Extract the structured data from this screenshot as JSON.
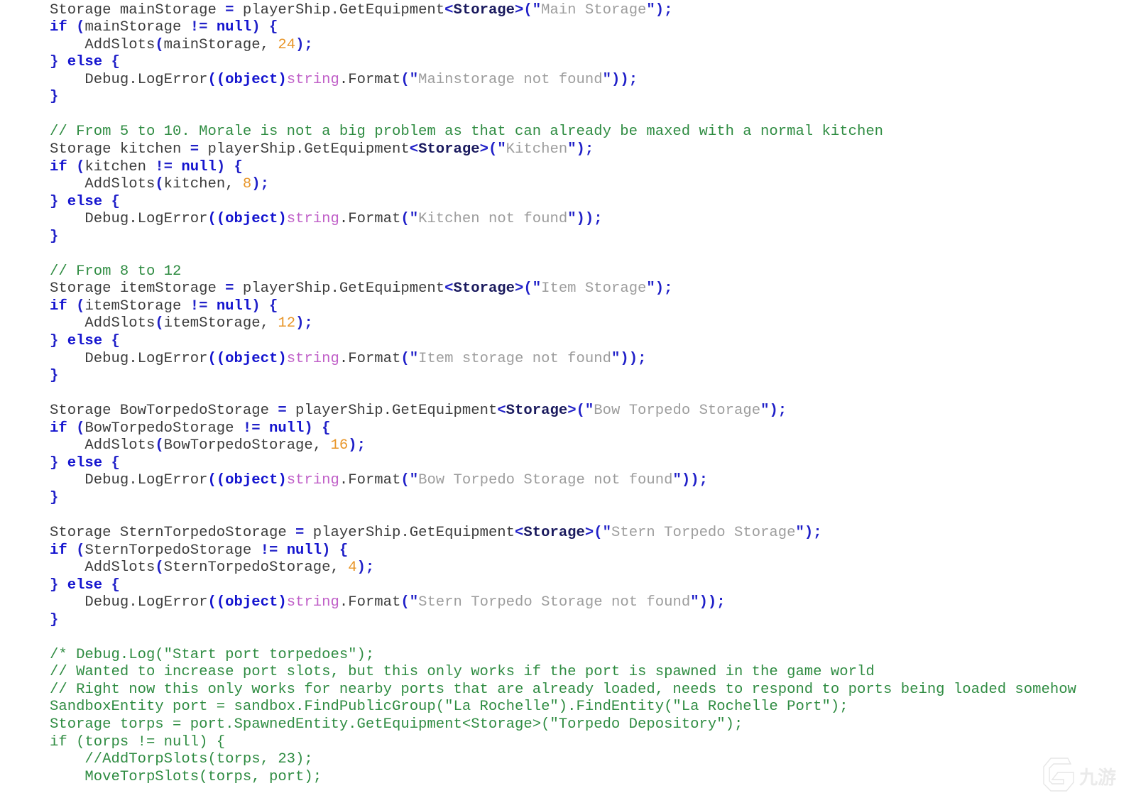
{
  "editor": {
    "background_color": "#ffffff",
    "language": "csharp",
    "font_size_px": 20.6,
    "line_height_px": 24.55,
    "theme_colors": {
      "plain": "#3c3c3c",
      "keyword": "#1414cf",
      "type": "#1a1a5e",
      "punctuation": "#2020c8",
      "number": "#e8962a",
      "string": "#9d9d9d",
      "string_quote": "#2020c8",
      "special_keyword": "#c060c8",
      "comment": "#2f8c42"
    }
  },
  "watermark": {
    "text": "九游",
    "color": "#c9c9c9"
  },
  "code": {
    "lines": [
      [
        {
          "t": "Storage mainStorage ",
          "c": "plain"
        },
        {
          "t": "=",
          "c": "punc"
        },
        {
          "t": " playerShip",
          "c": "plain"
        },
        {
          "t": ".",
          "c": "plain"
        },
        {
          "t": "GetEquipment",
          "c": "plain"
        },
        {
          "t": "<",
          "c": "punc"
        },
        {
          "t": "Storage",
          "c": "type"
        },
        {
          "t": ">",
          "c": "punc"
        },
        {
          "t": "(",
          "c": "punc"
        },
        {
          "t": "\"",
          "c": "strq"
        },
        {
          "t": "Main Storage",
          "c": "str"
        },
        {
          "t": "\"",
          "c": "strq"
        },
        {
          "t": ")",
          "c": "punc"
        },
        {
          "t": ";",
          "c": "punc"
        }
      ],
      [
        {
          "t": "if",
          "c": "kw"
        },
        {
          "t": " ",
          "c": "plain"
        },
        {
          "t": "(",
          "c": "punc"
        },
        {
          "t": "mainStorage ",
          "c": "plain"
        },
        {
          "t": "!=",
          "c": "punc"
        },
        {
          "t": " ",
          "c": "plain"
        },
        {
          "t": "null",
          "c": "kw"
        },
        {
          "t": ")",
          "c": "punc"
        },
        {
          "t": " ",
          "c": "plain"
        },
        {
          "t": "{",
          "c": "punc"
        }
      ],
      [
        {
          "t": "    AddSlots",
          "c": "plain"
        },
        {
          "t": "(",
          "c": "punc"
        },
        {
          "t": "mainStorage, ",
          "c": "plain"
        },
        {
          "t": "24",
          "c": "num"
        },
        {
          "t": ")",
          "c": "punc"
        },
        {
          "t": ";",
          "c": "punc"
        }
      ],
      [
        {
          "t": "}",
          "c": "punc"
        },
        {
          "t": " ",
          "c": "plain"
        },
        {
          "t": "else",
          "c": "kw"
        },
        {
          "t": " ",
          "c": "plain"
        },
        {
          "t": "{",
          "c": "punc"
        }
      ],
      [
        {
          "t": "    Debug",
          "c": "plain"
        },
        {
          "t": ".",
          "c": "plain"
        },
        {
          "t": "LogError",
          "c": "plain"
        },
        {
          "t": "((object)",
          "c": "cast"
        },
        {
          "t": "string",
          "c": "special"
        },
        {
          "t": ".",
          "c": "plain"
        },
        {
          "t": "Format",
          "c": "plain"
        },
        {
          "t": "(",
          "c": "punc"
        },
        {
          "t": "\"",
          "c": "strq"
        },
        {
          "t": "Mainstorage not found",
          "c": "str"
        },
        {
          "t": "\"",
          "c": "strq"
        },
        {
          "t": "))",
          "c": "punc"
        },
        {
          "t": ";",
          "c": "punc"
        }
      ],
      [
        {
          "t": "}",
          "c": "punc"
        }
      ],
      [],
      [
        {
          "t": "// From 5 to 10. Morale is not a big problem as that can already be maxed with a normal kitchen",
          "c": "comment"
        }
      ],
      [
        {
          "t": "Storage kitchen ",
          "c": "plain"
        },
        {
          "t": "=",
          "c": "punc"
        },
        {
          "t": " playerShip",
          "c": "plain"
        },
        {
          "t": ".",
          "c": "plain"
        },
        {
          "t": "GetEquipment",
          "c": "plain"
        },
        {
          "t": "<",
          "c": "punc"
        },
        {
          "t": "Storage",
          "c": "type"
        },
        {
          "t": ">",
          "c": "punc"
        },
        {
          "t": "(",
          "c": "punc"
        },
        {
          "t": "\"",
          "c": "strq"
        },
        {
          "t": "Kitchen",
          "c": "str"
        },
        {
          "t": "\"",
          "c": "strq"
        },
        {
          "t": ")",
          "c": "punc"
        },
        {
          "t": ";",
          "c": "punc"
        }
      ],
      [
        {
          "t": "if",
          "c": "kw"
        },
        {
          "t": " ",
          "c": "plain"
        },
        {
          "t": "(",
          "c": "punc"
        },
        {
          "t": "kitchen ",
          "c": "plain"
        },
        {
          "t": "!=",
          "c": "punc"
        },
        {
          "t": " ",
          "c": "plain"
        },
        {
          "t": "null",
          "c": "kw"
        },
        {
          "t": ")",
          "c": "punc"
        },
        {
          "t": " ",
          "c": "plain"
        },
        {
          "t": "{",
          "c": "punc"
        }
      ],
      [
        {
          "t": "    AddSlots",
          "c": "plain"
        },
        {
          "t": "(",
          "c": "punc"
        },
        {
          "t": "kitchen, ",
          "c": "plain"
        },
        {
          "t": "8",
          "c": "num"
        },
        {
          "t": ")",
          "c": "punc"
        },
        {
          "t": ";",
          "c": "punc"
        }
      ],
      [
        {
          "t": "}",
          "c": "punc"
        },
        {
          "t": " ",
          "c": "plain"
        },
        {
          "t": "else",
          "c": "kw"
        },
        {
          "t": " ",
          "c": "plain"
        },
        {
          "t": "{",
          "c": "punc"
        }
      ],
      [
        {
          "t": "    Debug",
          "c": "plain"
        },
        {
          "t": ".",
          "c": "plain"
        },
        {
          "t": "LogError",
          "c": "plain"
        },
        {
          "t": "((object)",
          "c": "cast"
        },
        {
          "t": "string",
          "c": "special"
        },
        {
          "t": ".",
          "c": "plain"
        },
        {
          "t": "Format",
          "c": "plain"
        },
        {
          "t": "(",
          "c": "punc"
        },
        {
          "t": "\"",
          "c": "strq"
        },
        {
          "t": "Kitchen not found",
          "c": "str"
        },
        {
          "t": "\"",
          "c": "strq"
        },
        {
          "t": "))",
          "c": "punc"
        },
        {
          "t": ";",
          "c": "punc"
        }
      ],
      [
        {
          "t": "}",
          "c": "punc"
        }
      ],
      [],
      [
        {
          "t": "// From 8 to 12",
          "c": "comment"
        }
      ],
      [
        {
          "t": "Storage itemStorage ",
          "c": "plain"
        },
        {
          "t": "=",
          "c": "punc"
        },
        {
          "t": " playerShip",
          "c": "plain"
        },
        {
          "t": ".",
          "c": "plain"
        },
        {
          "t": "GetEquipment",
          "c": "plain"
        },
        {
          "t": "<",
          "c": "punc"
        },
        {
          "t": "Storage",
          "c": "type"
        },
        {
          "t": ">",
          "c": "punc"
        },
        {
          "t": "(",
          "c": "punc"
        },
        {
          "t": "\"",
          "c": "strq"
        },
        {
          "t": "Item Storage",
          "c": "str"
        },
        {
          "t": "\"",
          "c": "strq"
        },
        {
          "t": ")",
          "c": "punc"
        },
        {
          "t": ";",
          "c": "punc"
        }
      ],
      [
        {
          "t": "if",
          "c": "kw"
        },
        {
          "t": " ",
          "c": "plain"
        },
        {
          "t": "(",
          "c": "punc"
        },
        {
          "t": "itemStorage ",
          "c": "plain"
        },
        {
          "t": "!=",
          "c": "punc"
        },
        {
          "t": " ",
          "c": "plain"
        },
        {
          "t": "null",
          "c": "kw"
        },
        {
          "t": ")",
          "c": "punc"
        },
        {
          "t": " ",
          "c": "plain"
        },
        {
          "t": "{",
          "c": "punc"
        }
      ],
      [
        {
          "t": "    AddSlots",
          "c": "plain"
        },
        {
          "t": "(",
          "c": "punc"
        },
        {
          "t": "itemStorage, ",
          "c": "plain"
        },
        {
          "t": "12",
          "c": "num"
        },
        {
          "t": ")",
          "c": "punc"
        },
        {
          "t": ";",
          "c": "punc"
        }
      ],
      [
        {
          "t": "}",
          "c": "punc"
        },
        {
          "t": " ",
          "c": "plain"
        },
        {
          "t": "else",
          "c": "kw"
        },
        {
          "t": " ",
          "c": "plain"
        },
        {
          "t": "{",
          "c": "punc"
        }
      ],
      [
        {
          "t": "    Debug",
          "c": "plain"
        },
        {
          "t": ".",
          "c": "plain"
        },
        {
          "t": "LogError",
          "c": "plain"
        },
        {
          "t": "((object)",
          "c": "cast"
        },
        {
          "t": "string",
          "c": "special"
        },
        {
          "t": ".",
          "c": "plain"
        },
        {
          "t": "Format",
          "c": "plain"
        },
        {
          "t": "(",
          "c": "punc"
        },
        {
          "t": "\"",
          "c": "strq"
        },
        {
          "t": "Item storage not found",
          "c": "str"
        },
        {
          "t": "\"",
          "c": "strq"
        },
        {
          "t": "))",
          "c": "punc"
        },
        {
          "t": ";",
          "c": "punc"
        }
      ],
      [
        {
          "t": "}",
          "c": "punc"
        }
      ],
      [],
      [
        {
          "t": "Storage BowTorpedoStorage ",
          "c": "plain"
        },
        {
          "t": "=",
          "c": "punc"
        },
        {
          "t": " playerShip",
          "c": "plain"
        },
        {
          "t": ".",
          "c": "plain"
        },
        {
          "t": "GetEquipment",
          "c": "plain"
        },
        {
          "t": "<",
          "c": "punc"
        },
        {
          "t": "Storage",
          "c": "type"
        },
        {
          "t": ">",
          "c": "punc"
        },
        {
          "t": "(",
          "c": "punc"
        },
        {
          "t": "\"",
          "c": "strq"
        },
        {
          "t": "Bow Torpedo Storage",
          "c": "str"
        },
        {
          "t": "\"",
          "c": "strq"
        },
        {
          "t": ")",
          "c": "punc"
        },
        {
          "t": ";",
          "c": "punc"
        }
      ],
      [
        {
          "t": "if",
          "c": "kw"
        },
        {
          "t": " ",
          "c": "plain"
        },
        {
          "t": "(",
          "c": "punc"
        },
        {
          "t": "BowTorpedoStorage ",
          "c": "plain"
        },
        {
          "t": "!=",
          "c": "punc"
        },
        {
          "t": " ",
          "c": "plain"
        },
        {
          "t": "null",
          "c": "kw"
        },
        {
          "t": ")",
          "c": "punc"
        },
        {
          "t": " ",
          "c": "plain"
        },
        {
          "t": "{",
          "c": "punc"
        }
      ],
      [
        {
          "t": "    AddSlots",
          "c": "plain"
        },
        {
          "t": "(",
          "c": "punc"
        },
        {
          "t": "BowTorpedoStorage, ",
          "c": "plain"
        },
        {
          "t": "16",
          "c": "num"
        },
        {
          "t": ")",
          "c": "punc"
        },
        {
          "t": ";",
          "c": "punc"
        }
      ],
      [
        {
          "t": "}",
          "c": "punc"
        },
        {
          "t": " ",
          "c": "plain"
        },
        {
          "t": "else",
          "c": "kw"
        },
        {
          "t": " ",
          "c": "plain"
        },
        {
          "t": "{",
          "c": "punc"
        }
      ],
      [
        {
          "t": "    Debug",
          "c": "plain"
        },
        {
          "t": ".",
          "c": "plain"
        },
        {
          "t": "LogError",
          "c": "plain"
        },
        {
          "t": "((object)",
          "c": "cast"
        },
        {
          "t": "string",
          "c": "special"
        },
        {
          "t": ".",
          "c": "plain"
        },
        {
          "t": "Format",
          "c": "plain"
        },
        {
          "t": "(",
          "c": "punc"
        },
        {
          "t": "\"",
          "c": "strq"
        },
        {
          "t": "Bow Torpedo Storage not found",
          "c": "str"
        },
        {
          "t": "\"",
          "c": "strq"
        },
        {
          "t": "))",
          "c": "punc"
        },
        {
          "t": ";",
          "c": "punc"
        }
      ],
      [
        {
          "t": "}",
          "c": "punc"
        }
      ],
      [],
      [
        {
          "t": "Storage SternTorpedoStorage ",
          "c": "plain"
        },
        {
          "t": "=",
          "c": "punc"
        },
        {
          "t": " playerShip",
          "c": "plain"
        },
        {
          "t": ".",
          "c": "plain"
        },
        {
          "t": "GetEquipment",
          "c": "plain"
        },
        {
          "t": "<",
          "c": "punc"
        },
        {
          "t": "Storage",
          "c": "type"
        },
        {
          "t": ">",
          "c": "punc"
        },
        {
          "t": "(",
          "c": "punc"
        },
        {
          "t": "\"",
          "c": "strq"
        },
        {
          "t": "Stern Torpedo Storage",
          "c": "str"
        },
        {
          "t": "\"",
          "c": "strq"
        },
        {
          "t": ")",
          "c": "punc"
        },
        {
          "t": ";",
          "c": "punc"
        }
      ],
      [
        {
          "t": "if",
          "c": "kw"
        },
        {
          "t": " ",
          "c": "plain"
        },
        {
          "t": "(",
          "c": "punc"
        },
        {
          "t": "SternTorpedoStorage ",
          "c": "plain"
        },
        {
          "t": "!=",
          "c": "punc"
        },
        {
          "t": " ",
          "c": "plain"
        },
        {
          "t": "null",
          "c": "kw"
        },
        {
          "t": ")",
          "c": "punc"
        },
        {
          "t": " ",
          "c": "plain"
        },
        {
          "t": "{",
          "c": "punc"
        }
      ],
      [
        {
          "t": "    AddSlots",
          "c": "plain"
        },
        {
          "t": "(",
          "c": "punc"
        },
        {
          "t": "SternTorpedoStorage, ",
          "c": "plain"
        },
        {
          "t": "4",
          "c": "num"
        },
        {
          "t": ")",
          "c": "punc"
        },
        {
          "t": ";",
          "c": "punc"
        }
      ],
      [
        {
          "t": "}",
          "c": "punc"
        },
        {
          "t": " ",
          "c": "plain"
        },
        {
          "t": "else",
          "c": "kw"
        },
        {
          "t": " ",
          "c": "plain"
        },
        {
          "t": "{",
          "c": "punc"
        }
      ],
      [
        {
          "t": "    Debug",
          "c": "plain"
        },
        {
          "t": ".",
          "c": "plain"
        },
        {
          "t": "LogError",
          "c": "plain"
        },
        {
          "t": "((object)",
          "c": "cast"
        },
        {
          "t": "string",
          "c": "special"
        },
        {
          "t": ".",
          "c": "plain"
        },
        {
          "t": "Format",
          "c": "plain"
        },
        {
          "t": "(",
          "c": "punc"
        },
        {
          "t": "\"",
          "c": "strq"
        },
        {
          "t": "Stern Torpedo Storage not found",
          "c": "str"
        },
        {
          "t": "\"",
          "c": "strq"
        },
        {
          "t": "))",
          "c": "punc"
        },
        {
          "t": ";",
          "c": "punc"
        }
      ],
      [
        {
          "t": "}",
          "c": "punc"
        }
      ],
      [],
      [
        {
          "t": "/* Debug.Log(\"Start port torpedoes\");",
          "c": "comment"
        }
      ],
      [
        {
          "t": "// Wanted to increase port slots, but this only works if the port is spawned in the game world",
          "c": "comment"
        }
      ],
      [
        {
          "t": "// Right now this only works for nearby ports that are already loaded, needs to respond to ports being loaded somehow",
          "c": "comment"
        }
      ],
      [
        {
          "t": "SandboxEntity port = sandbox.FindPublicGroup(\"La Rochelle\").FindEntity(\"La Rochelle Port\");",
          "c": "comment"
        }
      ],
      [
        {
          "t": "Storage torps = port.SpawnedEntity.GetEquipment<Storage>(\"Torpedo Depository\");",
          "c": "comment"
        }
      ],
      [
        {
          "t": "if (torps != null) {",
          "c": "comment"
        }
      ],
      [
        {
          "t": "    //AddTorpSlots(torps, 23);",
          "c": "comment"
        }
      ],
      [
        {
          "t": "    MoveTorpSlots(torps, port);",
          "c": "comment"
        }
      ]
    ]
  }
}
